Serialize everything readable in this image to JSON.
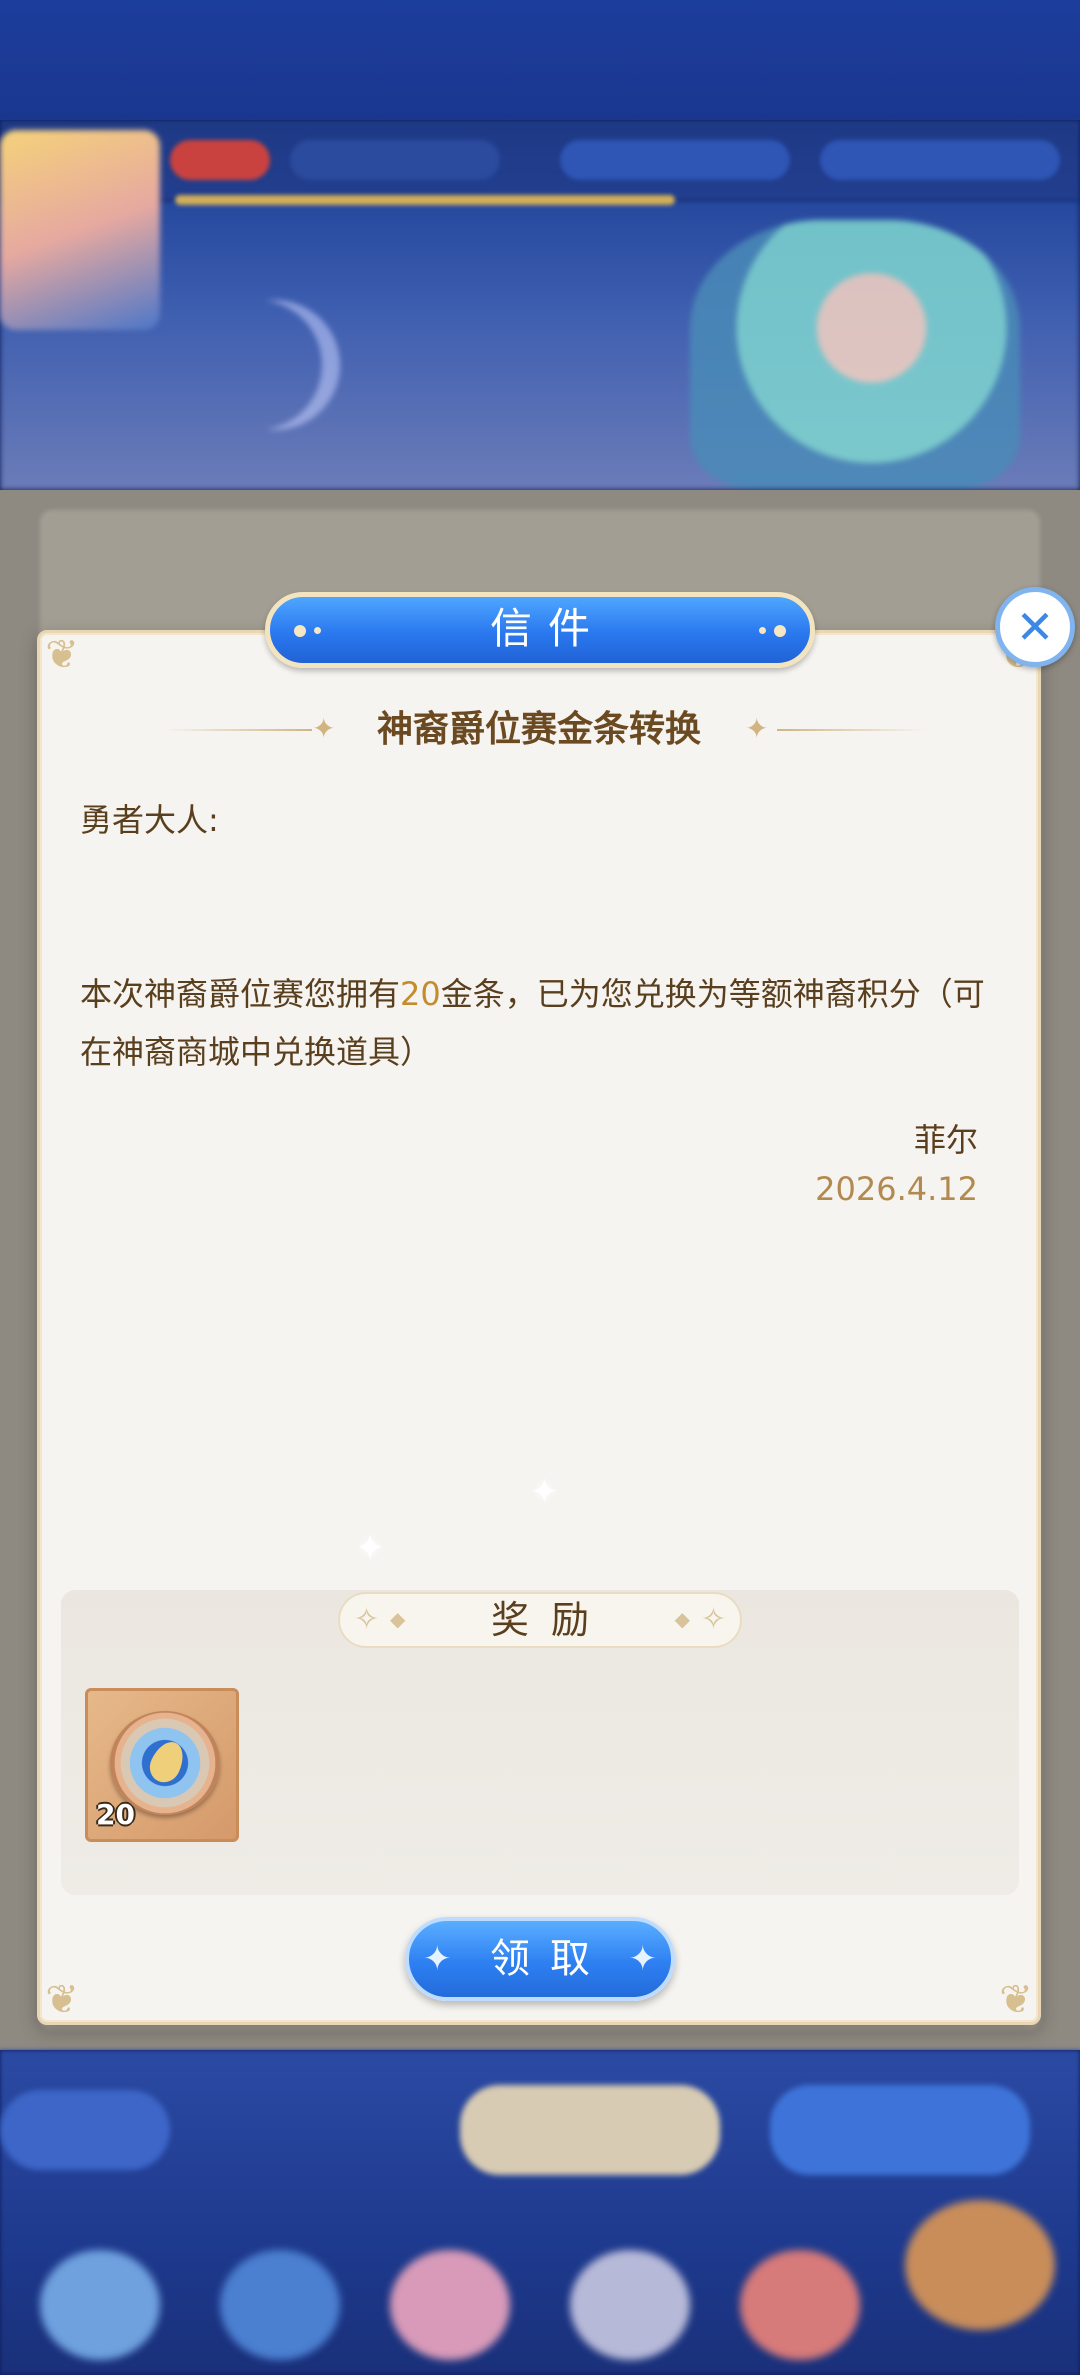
{
  "dialog": {
    "header_title": "信件",
    "close_glyph": "✕",
    "subject": "神裔爵位赛金条转换",
    "salutation": "勇者大人:",
    "body_before": "本次神裔爵位赛您拥有",
    "body_amount": "20",
    "body_after": "金条，已为您兑换为等额神裔积分（可在神裔商城中兑换道具）",
    "signer": "菲尔",
    "date": "2026.4.12",
    "rewards_title": "奖励",
    "reward_items": [
      {
        "icon": "divine-points-coin-icon",
        "count": "20"
      }
    ],
    "claim_label": "领取"
  },
  "colors": {
    "accent_blue": "#2a78ef",
    "text_brown": "#5a3f1e",
    "highlight_gold": "#c58b2c",
    "date_color": "#b28a50",
    "paper": "#f6f4f0"
  }
}
